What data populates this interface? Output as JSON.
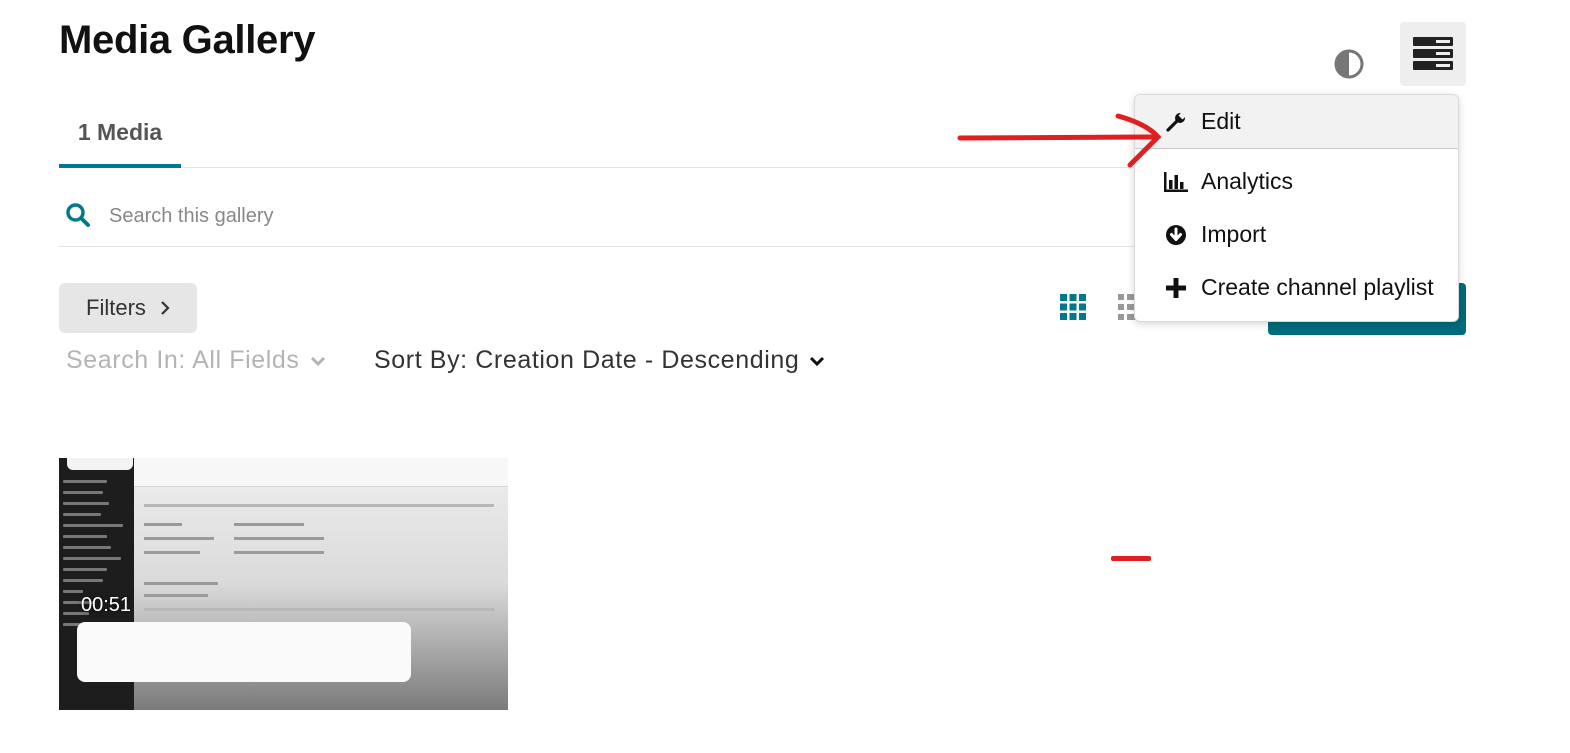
{
  "page": {
    "title": "Media Gallery"
  },
  "header": {
    "contrast_icon": "contrast-icon",
    "menu_icon": "server-stack-icon"
  },
  "tabs": [
    {
      "label": "1 Media",
      "active": true
    }
  ],
  "search": {
    "placeholder": "Search this gallery",
    "value": ""
  },
  "toolbar": {
    "filters_label": "Filters",
    "search_in_label": "Search In: All Fields",
    "sort_by_label": "Sort By: Creation Date - Descending",
    "view_modes": [
      "grid-view-icon",
      "list-view-icon"
    ]
  },
  "dropdown": {
    "items": [
      {
        "label": "Edit",
        "icon": "wrench-icon",
        "highlighted": true
      },
      {
        "label": "Analytics",
        "icon": "bar-chart-icon",
        "highlighted": false
      },
      {
        "label": "Import",
        "icon": "download-circle-icon",
        "highlighted": false
      },
      {
        "label": "Create channel playlist",
        "icon": "plus-icon",
        "highlighted": false
      }
    ]
  },
  "media": [
    {
      "duration": "00:51"
    }
  ],
  "colors": {
    "accent": "#00798c",
    "annotation": "#e02020",
    "button_teal": "#006b7c"
  }
}
